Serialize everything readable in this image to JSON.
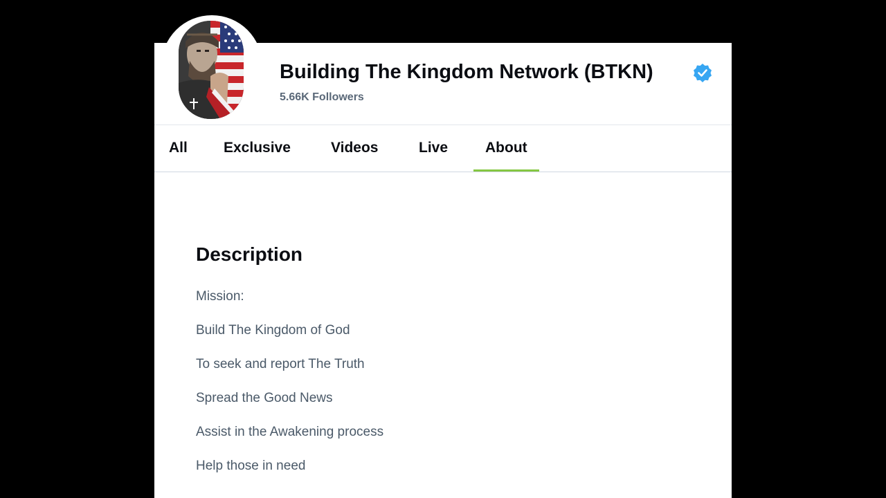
{
  "channel": {
    "name": "Building The Kingdom Network (BTKN)",
    "followers": "5.66K Followers",
    "verified": true,
    "avatar_icon": "channel-avatar-icon"
  },
  "tabs": [
    {
      "label": "All",
      "active": false
    },
    {
      "label": "Exclusive",
      "active": false
    },
    {
      "label": "Videos",
      "active": false
    },
    {
      "label": "Live",
      "active": false
    },
    {
      "label": "About",
      "active": true
    }
  ],
  "about": {
    "heading": "Description",
    "lines": [
      "Mission:",
      "Build The Kingdom of God",
      "To seek and report The Truth",
      "Spread the Good News",
      "Assist in the Awakening process",
      "Help those in need"
    ]
  },
  "colors": {
    "background": "#000000",
    "panel": "#ffffff",
    "active_tab_underline": "#85c742",
    "verified_badge": "#37a6f2",
    "text_primary": "#0b0d12",
    "text_secondary": "#4a5968"
  }
}
